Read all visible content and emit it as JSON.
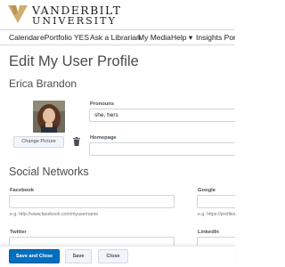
{
  "header": {
    "logo_line1": "VANDERBILT",
    "logo_line2": "UNIVERSITY",
    "brand_color": "#cfae70"
  },
  "nav": {
    "items": [
      "Calendar",
      "ePortfolio",
      "YES",
      "Ask a Librarian",
      "My Media",
      "Help ▾",
      "Insights Portal"
    ]
  },
  "page": {
    "title": "Edit My User Profile",
    "user_name": "Erica Brandon"
  },
  "profile": {
    "change_picture_label": "Change Picture",
    "pronouns_label": "Pronouns",
    "pronouns_value": "she, hers",
    "homepage_label": "Homepage",
    "homepage_value": ""
  },
  "social": {
    "title": "Social Networks",
    "facebook_label": "Facebook",
    "facebook_hint": "e.g. http://www.facebook.com/myusername",
    "google_label": "Google",
    "google_hint": "e.g. https://profiles.",
    "twitter_label": "Twitter",
    "linkedin_label": "LinkedIn"
  },
  "footer": {
    "save_close_label": "Save and Close",
    "save_label": "Save",
    "close_label": "Close",
    "primary_color": "#006fbf"
  }
}
